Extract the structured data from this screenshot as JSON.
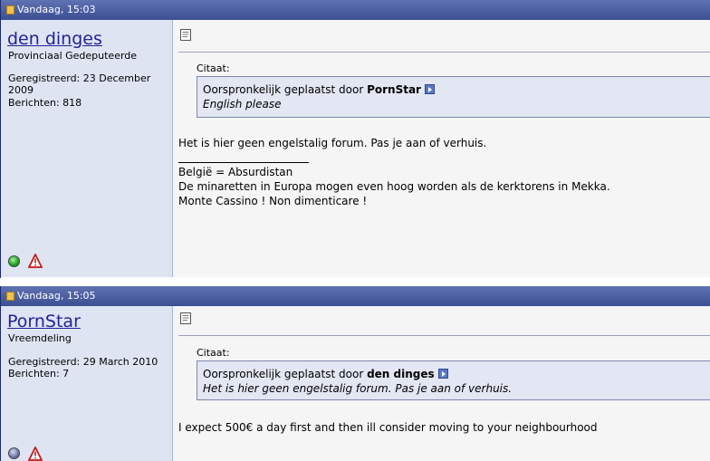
{
  "posts": [
    {
      "date": "Vandaag, 15:03",
      "username": "den dinges",
      "rank": "Provinciaal Gedeputeerde",
      "registered": "Geregistreerd: 23 December 2009",
      "posts_count": "Berichten: 818",
      "online": true,
      "quote_title": "Citaat:",
      "quote_prefix": "Oorspronkelijk geplaatst door",
      "quote_author": "PornStar",
      "quote_text": "English please",
      "message": "Het is hier geen engelstalig forum. Pas je aan of verhuis.",
      "signature": [
        "België = Absurdistan",
        "De minaretten in Europa mogen even hoog worden als de kerktorens in Mekka.",
        "Monte Cassino ! Non dimenticare !"
      ]
    },
    {
      "date": "Vandaag, 15:05",
      "username": "PornStar",
      "rank": "Vreemdeling",
      "registered": "Geregistreerd: 29 March 2010",
      "posts_count": "Berichten: 7",
      "online": false,
      "quote_title": "Citaat:",
      "quote_prefix": "Oorspronkelijk geplaatst door",
      "quote_author": "den dinges",
      "quote_text": "Het is hier geen engelstalig forum. Pas je aan of verhuis.",
      "message": "I expect 500€ a day first and then ill consider moving to your neighbourhood"
    }
  ],
  "icons": {
    "status_online": "online-status-icon",
    "status_offline": "offline-status-icon",
    "report": "report-warning-icon",
    "post": "post-document-icon",
    "view_post": "view-post-arrow-icon"
  }
}
